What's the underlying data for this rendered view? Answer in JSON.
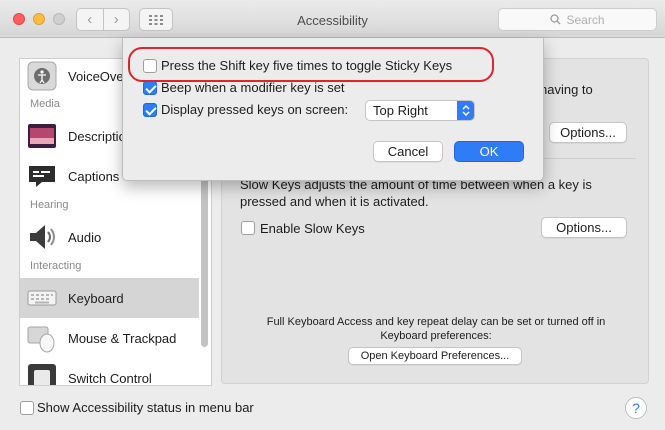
{
  "window": {
    "title": "Accessibility"
  },
  "search": {
    "placeholder": "Search"
  },
  "sidebar": {
    "items": [
      {
        "label": "VoiceOver",
        "icon": "voiceover-icon"
      },
      {
        "header": "Media"
      },
      {
        "label": "Descriptions",
        "icon": "descriptions-icon"
      },
      {
        "label": "Captions",
        "icon": "captions-icon"
      },
      {
        "header": "Hearing"
      },
      {
        "label": "Audio",
        "icon": "speaker-icon"
      },
      {
        "header": "Interacting"
      },
      {
        "label": "Keyboard",
        "icon": "keyboard-icon",
        "selected": true
      },
      {
        "label": "Mouse & Trackpad",
        "icon": "mouse-icon"
      },
      {
        "label": "Switch Control",
        "icon": "switch-control-icon"
      }
    ]
  },
  "panel": {
    "sticky_keys_text_tail": "having to",
    "options_label": "Options...",
    "slow_keys_description": "Slow Keys adjusts the amount of time between when a key is pressed and when it is activated.",
    "enable_slow_keys_label": "Enable Slow Keys",
    "enable_slow_keys_checked": false,
    "full_keyboard_access_text": "Full Keyboard Access and key repeat delay can be set or turned off in Keyboard preferences:",
    "open_keyboard_prefs_label": "Open Keyboard Preferences..."
  },
  "sheet": {
    "shift_five_times_label": "Press the Shift key five times to toggle Sticky Keys",
    "shift_five_times_checked": false,
    "beep_label": "Beep when a modifier key is set",
    "beep_checked": true,
    "display_keys_label": "Display pressed keys on screen:",
    "display_keys_checked": true,
    "position_value": "Top Right",
    "cancel_label": "Cancel",
    "ok_label": "OK"
  },
  "footer": {
    "status_menu_label": "Show Accessibility status in menu bar",
    "status_menu_checked": false,
    "help_label": "?"
  },
  "colors": {
    "accent": "#2e7cf6",
    "highlight_ring": "#e1222f"
  }
}
